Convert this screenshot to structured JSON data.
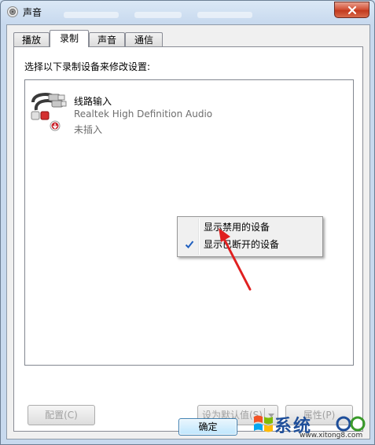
{
  "window": {
    "title": "声音"
  },
  "tabs": [
    {
      "label": "播放"
    },
    {
      "label": "录制"
    },
    {
      "label": "声音"
    },
    {
      "label": "通信"
    }
  ],
  "panel": {
    "instruction": "选择以下录制设备来修改设置:"
  },
  "device": {
    "name": "线路输入",
    "driver": "Realtek High Definition Audio",
    "status": "未插入"
  },
  "context_menu": {
    "items": [
      {
        "label": "显示禁用的设备",
        "checked": false
      },
      {
        "label": "显示已断开的设备",
        "checked": true
      }
    ]
  },
  "buttons": {
    "configure": "配置(C)",
    "set_default": "设为默认值(S)",
    "properties": "属性(P)",
    "ok": "确定"
  },
  "watermark": {
    "text": "系统",
    "url": "www.xitong8.com"
  },
  "colors": {
    "annotation_arrow": "#e02020",
    "check": "#1f5fbf"
  }
}
